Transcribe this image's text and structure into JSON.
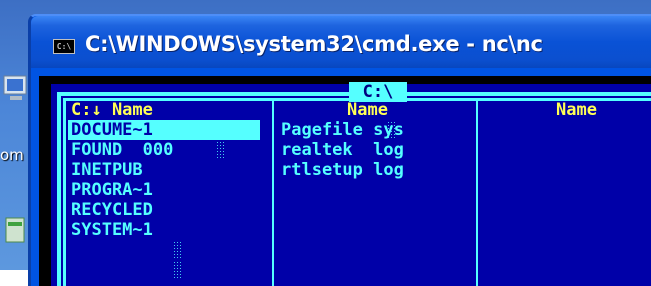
{
  "window": {
    "title": "C:\\WINDOWS\\system32\\cmd.exe - nc\\nc",
    "icon_text": "C:\\",
    "icon_name": "console-icon"
  },
  "desktop": {
    "partial_label": "om"
  },
  "nc": {
    "panel_title": "C:\\",
    "columns": [
      {
        "header": "C:↓ Name",
        "files": [
          "DOCUME~1",
          "FOUND  000",
          "INETPUB",
          "PROGRA~1",
          "RECYCLED",
          "SYSTEM~1"
        ]
      },
      {
        "header": "Name",
        "files": [
          "Pagefile sys",
          "realtek  log",
          "rtlsetup log"
        ]
      },
      {
        "header": "Name",
        "files": []
      }
    ],
    "colors": {
      "background": "#0000a8",
      "border": "#55ffff",
      "header": "#ffff55",
      "file": "#55ffff",
      "selection": "#55ffff"
    }
  }
}
